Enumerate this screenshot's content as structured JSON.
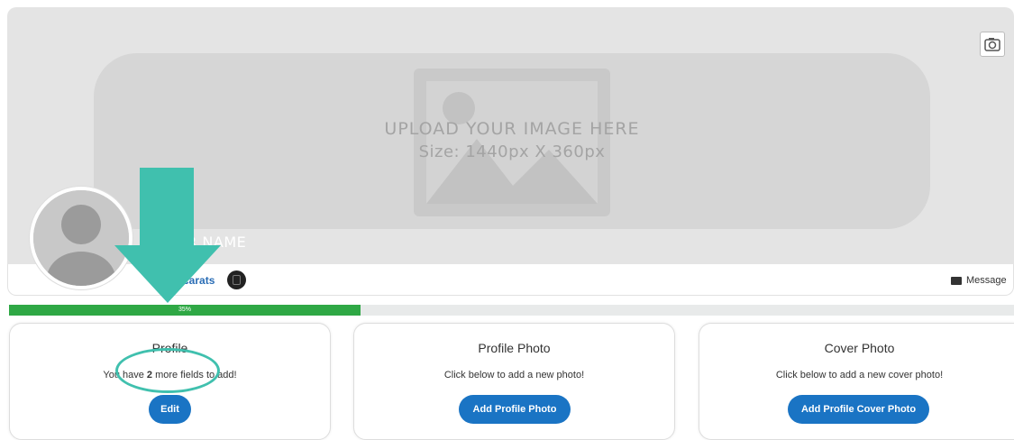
{
  "cover": {
    "upload_title": "UPLOAD YOUR IMAGE HERE",
    "upload_size": "Size: 1440px X 360px",
    "placeholder_icon": "image-placeholder-icon",
    "camera_icon": "camera-icon"
  },
  "profile": {
    "name": "UR NAME",
    "carats_label": "carats",
    "message_label": "Message"
  },
  "progress": {
    "percent": 35,
    "label": "35%",
    "fill_color": "#2fa845"
  },
  "cards": [
    {
      "title": "Profile",
      "description_prefix": "You have ",
      "description_count": "2",
      "description_suffix": " more fields to add!",
      "button_label": "Edit"
    },
    {
      "title": "Profile Photo",
      "description": "Click below to add a new photo!",
      "button_label": "Add Profile Photo"
    },
    {
      "title": "Cover Photo",
      "description": "Click below to add a new cover photo!",
      "button_label": "Add Profile Cover Photo"
    }
  ],
  "colors": {
    "accent_button": "#1a74c4",
    "annotation": "#40c0ae",
    "progress": "#2fa845"
  }
}
